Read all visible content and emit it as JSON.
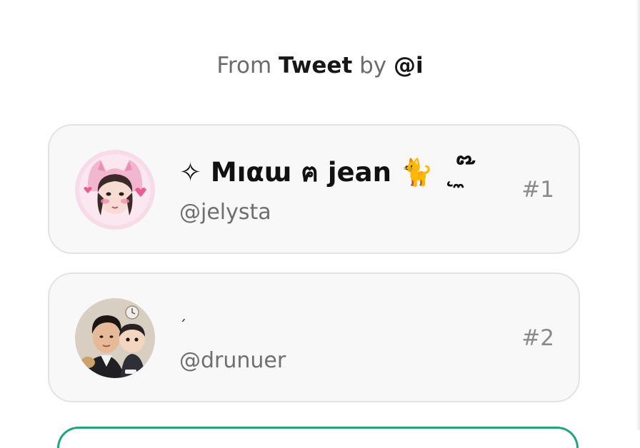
{
  "header": {
    "from_word": "From",
    "source": "Tweet",
    "by_word": "by",
    "author": "@i"
  },
  "entries": [
    {
      "name": "✧ Mıαɯ ฅ jean 🐈 ˛ ̼ ໊",
      "handle": "@jelysta",
      "rank": "#1",
      "avatar_icon": "pink-cat-ear-girl-avatar"
    },
    {
      "name": "ˏ",
      "handle": "@drunuer",
      "rank": "#2",
      "avatar_icon": "man-with-cartoon-avatar"
    }
  ],
  "colors": {
    "card_bg": "#f8f8f8",
    "card_border": "#e3e3e3",
    "accent_green": "#1fa67a",
    "muted_text": "#6f6f6f"
  }
}
